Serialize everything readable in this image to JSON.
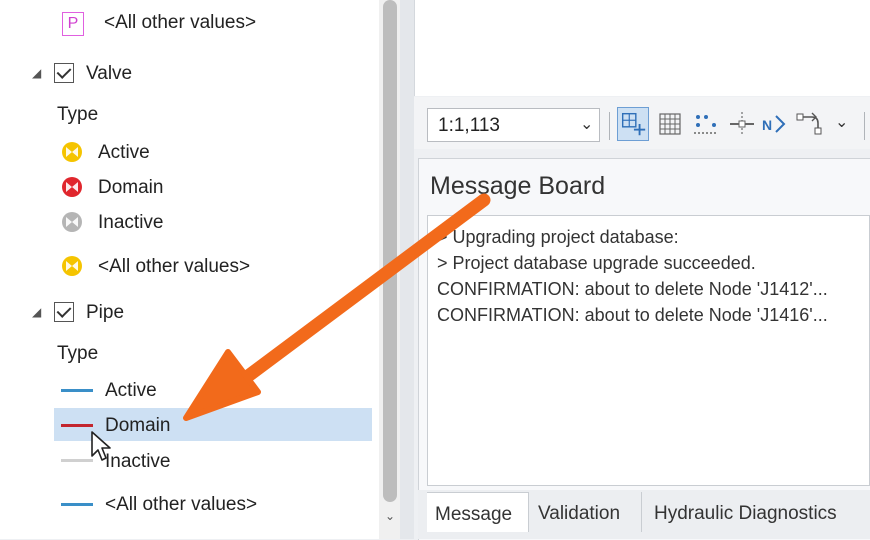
{
  "legend": {
    "prev_item": {
      "symbol_letter": "P",
      "label": "<All other values>"
    },
    "valve": {
      "name": "Valve",
      "type_heading": "Type",
      "items": [
        {
          "label": "Active",
          "color": "#f5c400"
        },
        {
          "label": "Domain",
          "color": "#e0262d"
        },
        {
          "label": "Inactive",
          "color": "#b5b5b5"
        },
        {
          "label": "<All other values>",
          "color": "#f5c400"
        }
      ]
    },
    "pipe": {
      "name": "Pipe",
      "type_heading": "Type",
      "items": [
        {
          "label": "Active",
          "color": "#3a8fc8"
        },
        {
          "label": "Domain",
          "color": "#c3262e"
        },
        {
          "label": "Inactive",
          "color": "#d0d0d0"
        },
        {
          "label": "<All other values>",
          "color": "#3a8fc8"
        }
      ]
    }
  },
  "map_toolbar": {
    "scale": "1:1,113"
  },
  "message_board": {
    "title": "Message Board",
    "lines": [
      "> Upgrading project database:",
      "> Project database upgrade succeeded.",
      "CONFIRMATION: about to delete Node 'J1412'...",
      "CONFIRMATION: about to delete Node 'J1416'..."
    ],
    "tabs": [
      "Message",
      "Validation",
      "Hydraulic Diagnostics"
    ]
  },
  "colors": {
    "arrow": "#f26a1b",
    "selection": "#cde0f3"
  }
}
